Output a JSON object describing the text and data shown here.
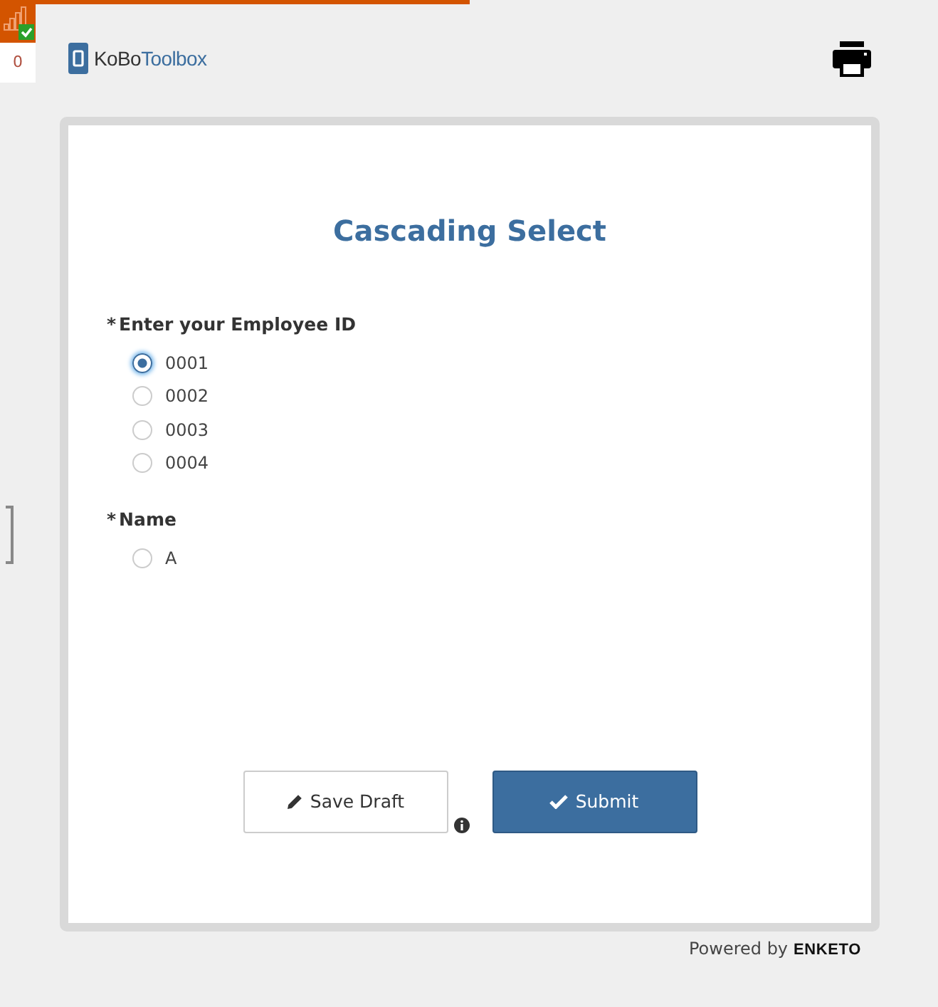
{
  "offline_queue": {
    "count": "0"
  },
  "header": {
    "logo_primary": "KoBo",
    "logo_secondary": "Toolbox"
  },
  "form": {
    "title": "Cascading Select",
    "questions": [
      {
        "required_marker": "*",
        "label": "Enter your Employee ID",
        "options": [
          {
            "label": "0001",
            "selected": true
          },
          {
            "label": "0002",
            "selected": false
          },
          {
            "label": "0003",
            "selected": false
          },
          {
            "label": "0004",
            "selected": false
          }
        ]
      },
      {
        "required_marker": "*",
        "label": "Name",
        "options": [
          {
            "label": "A",
            "selected": false
          }
        ]
      }
    ],
    "buttons": [
      {
        "kind": "draft",
        "label": "Save Draft"
      },
      {
        "kind": "submit",
        "label": "Submit"
      }
    ]
  },
  "footer": {
    "powered_by": "Powered by",
    "brand": "ENKETO"
  }
}
